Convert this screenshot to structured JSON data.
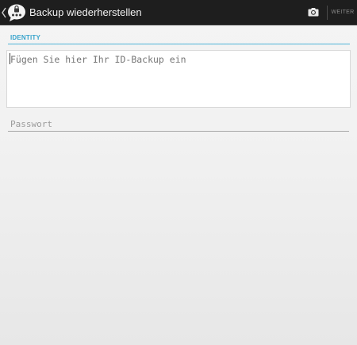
{
  "action_bar": {
    "title": "Backup wiederherstellen",
    "next_label": "WEITER",
    "icons": {
      "up": "chevron-left-icon",
      "app": "threema-logo-icon",
      "camera": "camera-icon"
    }
  },
  "form": {
    "section_label": "IDENTITY",
    "id_backup_placeholder": "Fügen Sie hier Ihr ID-Backup ein",
    "id_backup_value": "",
    "password_placeholder": "Passwort",
    "password_value": ""
  },
  "colors": {
    "action_bar_bg": "#1e1e1e",
    "accent": "#36a3cc",
    "page_bg": "#f2f2f2"
  }
}
